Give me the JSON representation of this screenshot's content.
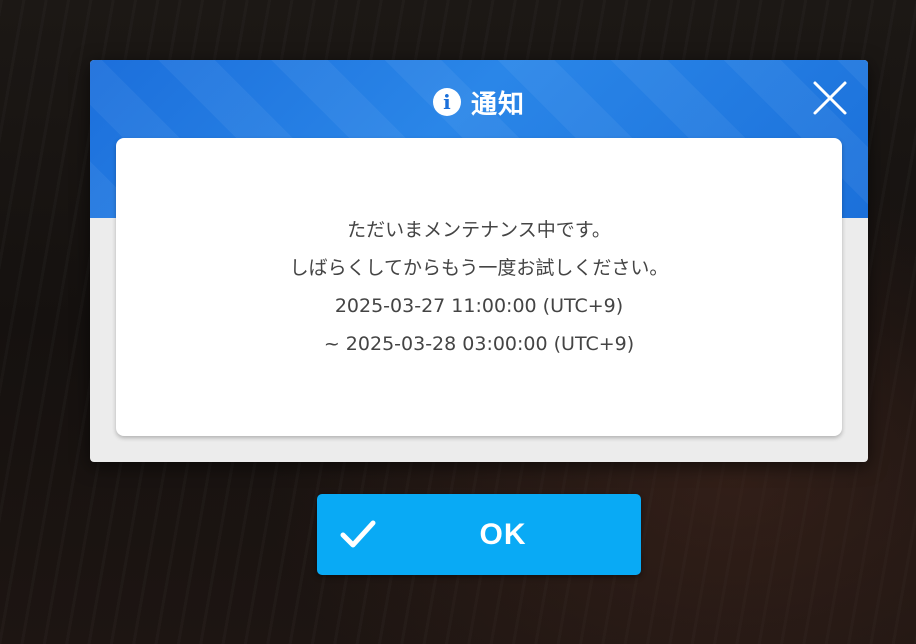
{
  "dialog": {
    "title": "通知",
    "title_icon": "info-icon",
    "close_icon": "close-icon",
    "message_lines": [
      "ただいまメンテナンス中です。",
      "しばらくしてからもう一度お試しください。",
      "2025-03-27 11:00:00 (UTC+9)",
      "~ 2025-03-28 03:00:00 (UTC+9)"
    ]
  },
  "ok_button": {
    "label": "OK",
    "icon": "check-icon"
  },
  "colors": {
    "header_blue": "#1c6fdb",
    "button_blue": "#09aaf5",
    "panel_bg": "#ececec",
    "text": "#444444"
  }
}
